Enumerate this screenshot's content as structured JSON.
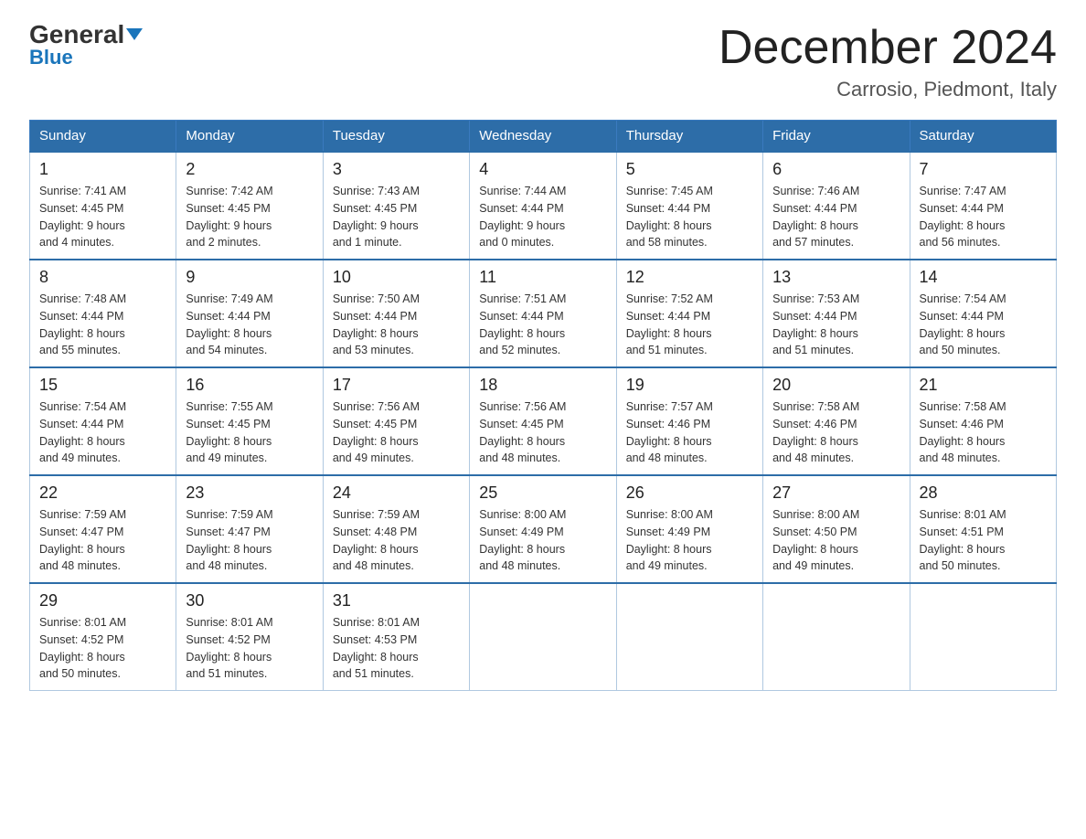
{
  "logo": {
    "text1": "General",
    "text2": "Blue"
  },
  "header": {
    "month": "December 2024",
    "location": "Carrosio, Piedmont, Italy"
  },
  "weekdays": [
    "Sunday",
    "Monday",
    "Tuesday",
    "Wednesday",
    "Thursday",
    "Friday",
    "Saturday"
  ],
  "weeks": [
    [
      {
        "day": "1",
        "info": "Sunrise: 7:41 AM\nSunset: 4:45 PM\nDaylight: 9 hours\nand 4 minutes."
      },
      {
        "day": "2",
        "info": "Sunrise: 7:42 AM\nSunset: 4:45 PM\nDaylight: 9 hours\nand 2 minutes."
      },
      {
        "day": "3",
        "info": "Sunrise: 7:43 AM\nSunset: 4:45 PM\nDaylight: 9 hours\nand 1 minute."
      },
      {
        "day": "4",
        "info": "Sunrise: 7:44 AM\nSunset: 4:44 PM\nDaylight: 9 hours\nand 0 minutes."
      },
      {
        "day": "5",
        "info": "Sunrise: 7:45 AM\nSunset: 4:44 PM\nDaylight: 8 hours\nand 58 minutes."
      },
      {
        "day": "6",
        "info": "Sunrise: 7:46 AM\nSunset: 4:44 PM\nDaylight: 8 hours\nand 57 minutes."
      },
      {
        "day": "7",
        "info": "Sunrise: 7:47 AM\nSunset: 4:44 PM\nDaylight: 8 hours\nand 56 minutes."
      }
    ],
    [
      {
        "day": "8",
        "info": "Sunrise: 7:48 AM\nSunset: 4:44 PM\nDaylight: 8 hours\nand 55 minutes."
      },
      {
        "day": "9",
        "info": "Sunrise: 7:49 AM\nSunset: 4:44 PM\nDaylight: 8 hours\nand 54 minutes."
      },
      {
        "day": "10",
        "info": "Sunrise: 7:50 AM\nSunset: 4:44 PM\nDaylight: 8 hours\nand 53 minutes."
      },
      {
        "day": "11",
        "info": "Sunrise: 7:51 AM\nSunset: 4:44 PM\nDaylight: 8 hours\nand 52 minutes."
      },
      {
        "day": "12",
        "info": "Sunrise: 7:52 AM\nSunset: 4:44 PM\nDaylight: 8 hours\nand 51 minutes."
      },
      {
        "day": "13",
        "info": "Sunrise: 7:53 AM\nSunset: 4:44 PM\nDaylight: 8 hours\nand 51 minutes."
      },
      {
        "day": "14",
        "info": "Sunrise: 7:54 AM\nSunset: 4:44 PM\nDaylight: 8 hours\nand 50 minutes."
      }
    ],
    [
      {
        "day": "15",
        "info": "Sunrise: 7:54 AM\nSunset: 4:44 PM\nDaylight: 8 hours\nand 49 minutes."
      },
      {
        "day": "16",
        "info": "Sunrise: 7:55 AM\nSunset: 4:45 PM\nDaylight: 8 hours\nand 49 minutes."
      },
      {
        "day": "17",
        "info": "Sunrise: 7:56 AM\nSunset: 4:45 PM\nDaylight: 8 hours\nand 49 minutes."
      },
      {
        "day": "18",
        "info": "Sunrise: 7:56 AM\nSunset: 4:45 PM\nDaylight: 8 hours\nand 48 minutes."
      },
      {
        "day": "19",
        "info": "Sunrise: 7:57 AM\nSunset: 4:46 PM\nDaylight: 8 hours\nand 48 minutes."
      },
      {
        "day": "20",
        "info": "Sunrise: 7:58 AM\nSunset: 4:46 PM\nDaylight: 8 hours\nand 48 minutes."
      },
      {
        "day": "21",
        "info": "Sunrise: 7:58 AM\nSunset: 4:46 PM\nDaylight: 8 hours\nand 48 minutes."
      }
    ],
    [
      {
        "day": "22",
        "info": "Sunrise: 7:59 AM\nSunset: 4:47 PM\nDaylight: 8 hours\nand 48 minutes."
      },
      {
        "day": "23",
        "info": "Sunrise: 7:59 AM\nSunset: 4:47 PM\nDaylight: 8 hours\nand 48 minutes."
      },
      {
        "day": "24",
        "info": "Sunrise: 7:59 AM\nSunset: 4:48 PM\nDaylight: 8 hours\nand 48 minutes."
      },
      {
        "day": "25",
        "info": "Sunrise: 8:00 AM\nSunset: 4:49 PM\nDaylight: 8 hours\nand 48 minutes."
      },
      {
        "day": "26",
        "info": "Sunrise: 8:00 AM\nSunset: 4:49 PM\nDaylight: 8 hours\nand 49 minutes."
      },
      {
        "day": "27",
        "info": "Sunrise: 8:00 AM\nSunset: 4:50 PM\nDaylight: 8 hours\nand 49 minutes."
      },
      {
        "day": "28",
        "info": "Sunrise: 8:01 AM\nSunset: 4:51 PM\nDaylight: 8 hours\nand 50 minutes."
      }
    ],
    [
      {
        "day": "29",
        "info": "Sunrise: 8:01 AM\nSunset: 4:52 PM\nDaylight: 8 hours\nand 50 minutes."
      },
      {
        "day": "30",
        "info": "Sunrise: 8:01 AM\nSunset: 4:52 PM\nDaylight: 8 hours\nand 51 minutes."
      },
      {
        "day": "31",
        "info": "Sunrise: 8:01 AM\nSunset: 4:53 PM\nDaylight: 8 hours\nand 51 minutes."
      },
      null,
      null,
      null,
      null
    ]
  ]
}
